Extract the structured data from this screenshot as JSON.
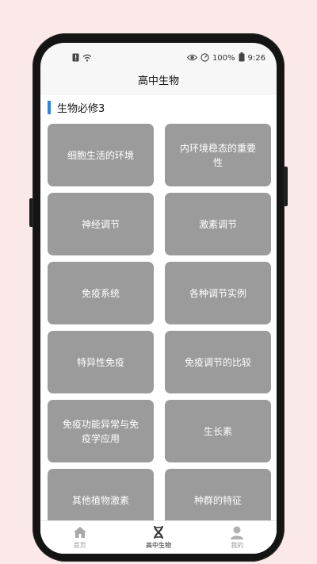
{
  "status_bar": {
    "battery_percent": "100%",
    "time": "9:26"
  },
  "header": {
    "title": "高中生物"
  },
  "section": {
    "title": "生物必修3"
  },
  "cards": [
    {
      "label": "细胞生活的环境"
    },
    {
      "label": "内环境稳态的重要性"
    },
    {
      "label": "神经调节"
    },
    {
      "label": "激素调节"
    },
    {
      "label": "免疫系统"
    },
    {
      "label": "各种调节实例"
    },
    {
      "label": "特异性免疫"
    },
    {
      "label": "免疫调节的比较"
    },
    {
      "label": "免疫功能异常与免疫学应用"
    },
    {
      "label": "生长素"
    },
    {
      "label": "其他植物激素"
    },
    {
      "label": "种群的特征"
    }
  ],
  "tabs": [
    {
      "label": "首页",
      "icon": "home-icon"
    },
    {
      "label": "高中生物",
      "icon": "dna-icon"
    },
    {
      "label": "我的",
      "icon": "person-icon"
    }
  ],
  "colors": {
    "background": "#fbe9ea",
    "card": "#9b9b9b",
    "accent": "#2f86d6"
  }
}
